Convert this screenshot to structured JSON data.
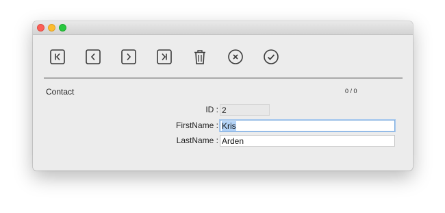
{
  "window": {
    "controls": {
      "close": "close-icon",
      "minimize": "minimize-icon",
      "zoom": "zoom-icon"
    }
  },
  "toolbar": {
    "buttons": [
      {
        "name": "first-record-button",
        "icon": "first-record-icon"
      },
      {
        "name": "previous-record-button",
        "icon": "previous-record-icon"
      },
      {
        "name": "next-record-button",
        "icon": "next-record-icon"
      },
      {
        "name": "last-record-button",
        "icon": "last-record-icon"
      },
      {
        "name": "delete-record-button",
        "icon": "trash-icon"
      },
      {
        "name": "cancel-button",
        "icon": "cancel-circle-icon"
      },
      {
        "name": "confirm-button",
        "icon": "check-circle-icon"
      }
    ]
  },
  "form": {
    "title": "Contact",
    "record_count": "0 / 0",
    "fields": {
      "id": {
        "label": "ID :",
        "value": "2"
      },
      "first_name": {
        "label": "FirstName :",
        "value": "Kris"
      },
      "last_name": {
        "label": "LastName :",
        "value": "Arden"
      }
    }
  },
  "colors": {
    "window_bg": "#ececec",
    "icon_stroke": "#3a3a3a",
    "focus_ring": "#7eaddf",
    "selection": "#b3d3f7"
  }
}
